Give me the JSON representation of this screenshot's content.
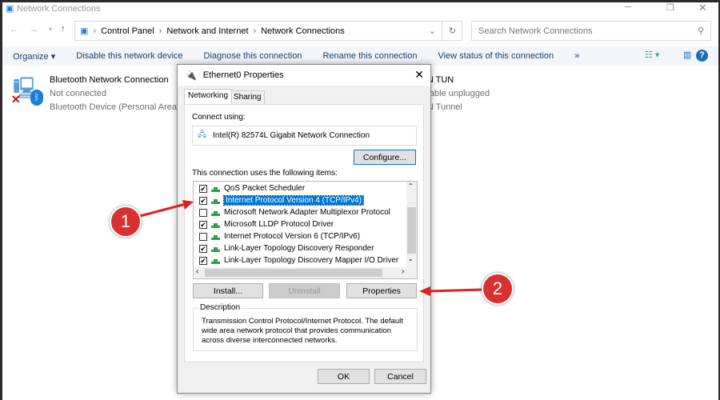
{
  "window": {
    "title": "Network Connections",
    "breadcrumb": [
      "Control Panel",
      "Network and Internet",
      "Network Connections"
    ],
    "search_placeholder": "Search Network Connections"
  },
  "toolbar": {
    "organize": "Organize ▾",
    "disable": "Disable this network device",
    "diagnose": "Diagnose this connection",
    "rename": "Rename this connection",
    "view_status": "View status of this connection",
    "more": "»"
  },
  "connections": [
    {
      "name": "Bluetooth Network Connection",
      "status": "Not connected",
      "device": "Bluetooth Device (Personal Area ..."
    },
    {
      "name": "...VPN TUN",
      "status": "...rk cable unplugged",
      "device": "...VPN Tunnel"
    }
  ],
  "dialog": {
    "title": "Ethernet0 Properties",
    "tabs": [
      "Networking",
      "Sharing"
    ],
    "connect_using_label": "Connect using:",
    "adapter": "Intel(R) 82574L Gigabit Network Connection",
    "configure": "Configure...",
    "items_label": "This connection uses the following items:",
    "items": [
      {
        "label": "QoS Packet Scheduler",
        "checked": true
      },
      {
        "label": "Internet Protocol Version 4 (TCP/IPv4)",
        "checked": true,
        "selected": true
      },
      {
        "label": "Microsoft Network Adapter Multiplexor Protocol",
        "checked": false
      },
      {
        "label": "Microsoft LLDP Protocol Driver",
        "checked": true
      },
      {
        "label": "Internet Protocol Version 6 (TCP/IPv6)",
        "checked": false
      },
      {
        "label": "Link-Layer Topology Discovery Responder",
        "checked": true
      },
      {
        "label": "Link-Layer Topology Discovery Mapper I/O Driver",
        "checked": true
      }
    ],
    "install": "Install...",
    "uninstall": "Uninstall",
    "properties": "Properties",
    "description_label": "Description",
    "description": "Transmission Control Protocol/Internet Protocol. The default wide area network protocol that provides communication across diverse interconnected networks.",
    "ok": "OK",
    "cancel": "Cancel"
  },
  "annotations": [
    "1",
    "2"
  ],
  "colors": {
    "annotation": "#d93030",
    "selection": "#0078d7"
  }
}
